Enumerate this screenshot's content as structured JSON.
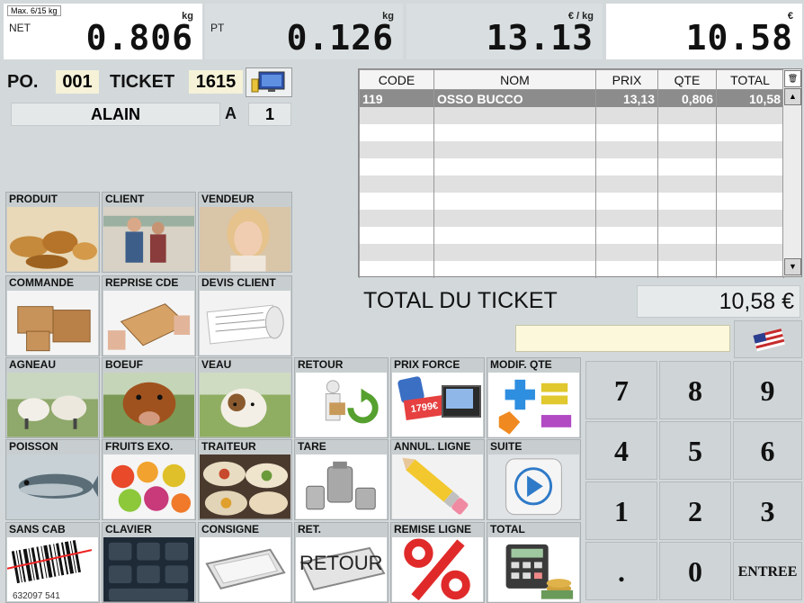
{
  "displays": {
    "max_label": "Max. 6/15 kg",
    "net": {
      "label": "NET",
      "unit": "kg",
      "value": "0.806"
    },
    "pt": {
      "label": "PT",
      "unit": "kg",
      "value": "0.126"
    },
    "price": {
      "unit": "€ / kg",
      "value": "13.13"
    },
    "total": {
      "unit": "€",
      "value": "10.58"
    }
  },
  "header": {
    "po_label": "PO.",
    "po_value": "001",
    "ticket_label": "TICKET",
    "ticket_value": "1615",
    "seller_name": "ALAIN",
    "a_label": "A",
    "a_value": "1"
  },
  "table": {
    "columns": [
      "CODE",
      "NOM",
      "PRIX",
      "QTE",
      "TOTAL"
    ],
    "rows": [
      {
        "code": "119",
        "nom": "OSSO BUCCO",
        "prix": "13,13",
        "qte": "0,806",
        "total": "10,58"
      }
    ]
  },
  "ticket_total": {
    "label": "TOTAL DU TICKET",
    "value": "10,58 €"
  },
  "tiles": {
    "produit": "PRODUIT",
    "client": "CLIENT",
    "vendeur": "VENDEUR",
    "commande": "COMMANDE",
    "reprise": "REPRISE CDE",
    "devis": "DEVIS CLIENT",
    "agneau": "AGNEAU",
    "boeuf": "BOEUF",
    "veau": "VEAU",
    "retour": "RETOUR",
    "prix_force": "PRIX FORCE",
    "modif_qte": "MODIF. QTE",
    "poisson": "POISSON",
    "fruits": "FRUITS EXO.",
    "traiteur": "TRAITEUR",
    "tare": "TARE",
    "annul": "ANNUL. LIGNE",
    "suite": "SUITE",
    "sans_cab": "SANS CAB",
    "clavier": "CLAVIER",
    "consigne": "CONSIGNE",
    "ret": "RET.",
    "remise": "REMISE LIGNE",
    "total": "TOTAL",
    "barcode_text": "632097 541",
    "ret_img_text": "RETOUR",
    "prix_force_img": "1799€"
  },
  "keypad": {
    "k7": "7",
    "k8": "8",
    "k9": "9",
    "k4": "4",
    "k5": "5",
    "k6": "6",
    "k1": "1",
    "k2": "2",
    "k3": "3",
    "kdot": ".",
    "k0": "0",
    "kenter": "ENTREE"
  }
}
